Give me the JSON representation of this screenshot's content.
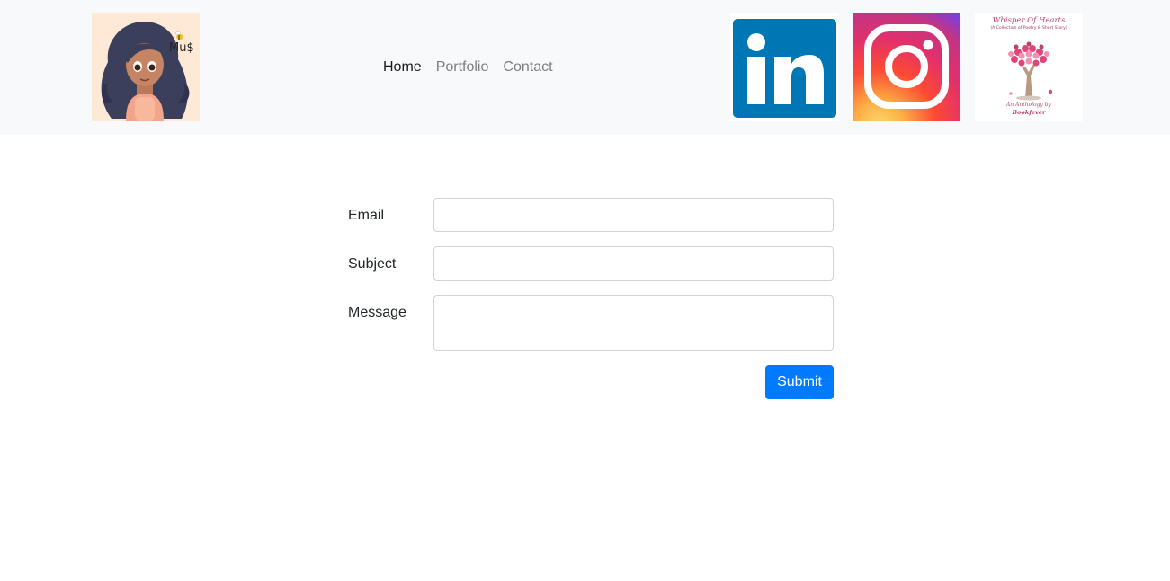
{
  "header": {
    "logo_text": "Mu$",
    "nav": [
      {
        "label": "Home",
        "active": true
      },
      {
        "label": "Portfolio",
        "active": false
      },
      {
        "label": "Contact",
        "active": false
      }
    ],
    "social": {
      "linkedin_icon": "linkedin-logo",
      "instagram_icon": "instagram-logo",
      "book": {
        "title": "Whisper Of Hearts",
        "subtitle": "(A Collection of Poetry & Short Story)",
        "byline_1": "An Anthology by",
        "byline_2": "Bookfever"
      }
    }
  },
  "form": {
    "email_label": "Email",
    "email_value": "",
    "subject_label": "Subject",
    "subject_value": "",
    "message_label": "Message",
    "message_value": "",
    "submit_label": "Submit"
  },
  "colors": {
    "navbar_bg": "#f8f9fa",
    "primary": "#007bff",
    "linkedin": "#0077b5"
  }
}
